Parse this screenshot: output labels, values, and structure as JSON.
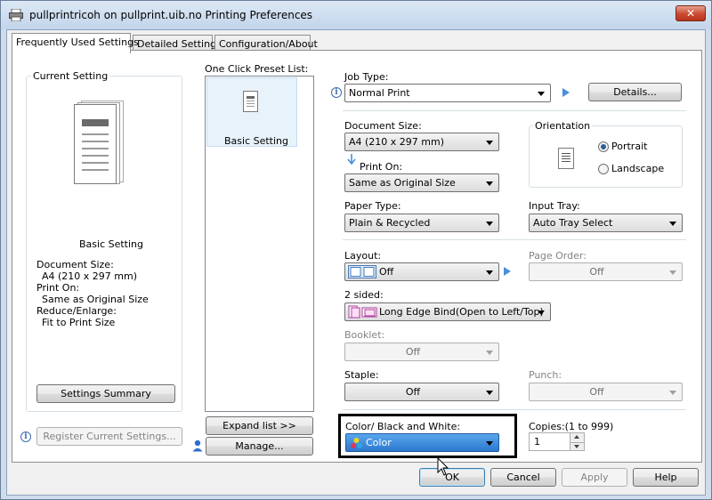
{
  "window": {
    "title": "pullprintricoh on pullprint.uib.no Printing Preferences",
    "close_glyph": "✕"
  },
  "tabs": [
    "Frequently Used Settings",
    "Detailed Settings",
    "Configuration/About"
  ],
  "current_setting": {
    "label": "Current Setting",
    "preset_name": "Basic Setting",
    "details": [
      {
        "key": "Document Size:",
        "value": "A4 (210 x 297 mm)"
      },
      {
        "key": "Print On:",
        "value": "Same as Original Size"
      },
      {
        "key": "Reduce/Enlarge:",
        "value": "Fit to Print Size"
      }
    ],
    "summary_button": "Settings Summary"
  },
  "register_button": "Register Current Settings...",
  "preset_list": {
    "label": "One Click Preset List:",
    "items": [
      "Basic Setting"
    ],
    "expand_button": "Expand list >>",
    "manage_button": "Manage..."
  },
  "job_type": {
    "label": "Job Type:",
    "value": "Normal Print",
    "details_button": "Details..."
  },
  "document_size": {
    "label": "Document Size:",
    "value": "A4 (210 x 297 mm)"
  },
  "print_on": {
    "label": "Print On:",
    "value": "Same as Original Size"
  },
  "orientation": {
    "label": "Orientation",
    "options": [
      "Portrait",
      "Landscape"
    ],
    "selected": "Portrait"
  },
  "paper_type": {
    "label": "Paper Type:",
    "value": "Plain & Recycled"
  },
  "input_tray": {
    "label": "Input Tray:",
    "value": "Auto Tray Select"
  },
  "layout": {
    "label": "Layout:",
    "value": "Off"
  },
  "page_order": {
    "label": "Page Order:",
    "value": "Off"
  },
  "two_sided": {
    "label": "2 sided:",
    "value": "Long Edge Bind(Open to Left/Top)"
  },
  "booklet": {
    "label": "Booklet:",
    "value": "Off"
  },
  "staple": {
    "label": "Staple:",
    "value": "Off"
  },
  "punch": {
    "label": "Punch:",
    "value": "Off"
  },
  "color_mode": {
    "label": "Color/ Black and White:",
    "value": "Color"
  },
  "copies": {
    "label": "Copies:(1 to 999)",
    "value": "1"
  },
  "footer": {
    "ok": "OK",
    "cancel": "Cancel",
    "apply": "Apply",
    "help": "Help"
  },
  "colors": {
    "highlight_border": "#000000",
    "accent_blue": "#4a8fdc",
    "selected_item_bg": "#e8f2fb"
  }
}
